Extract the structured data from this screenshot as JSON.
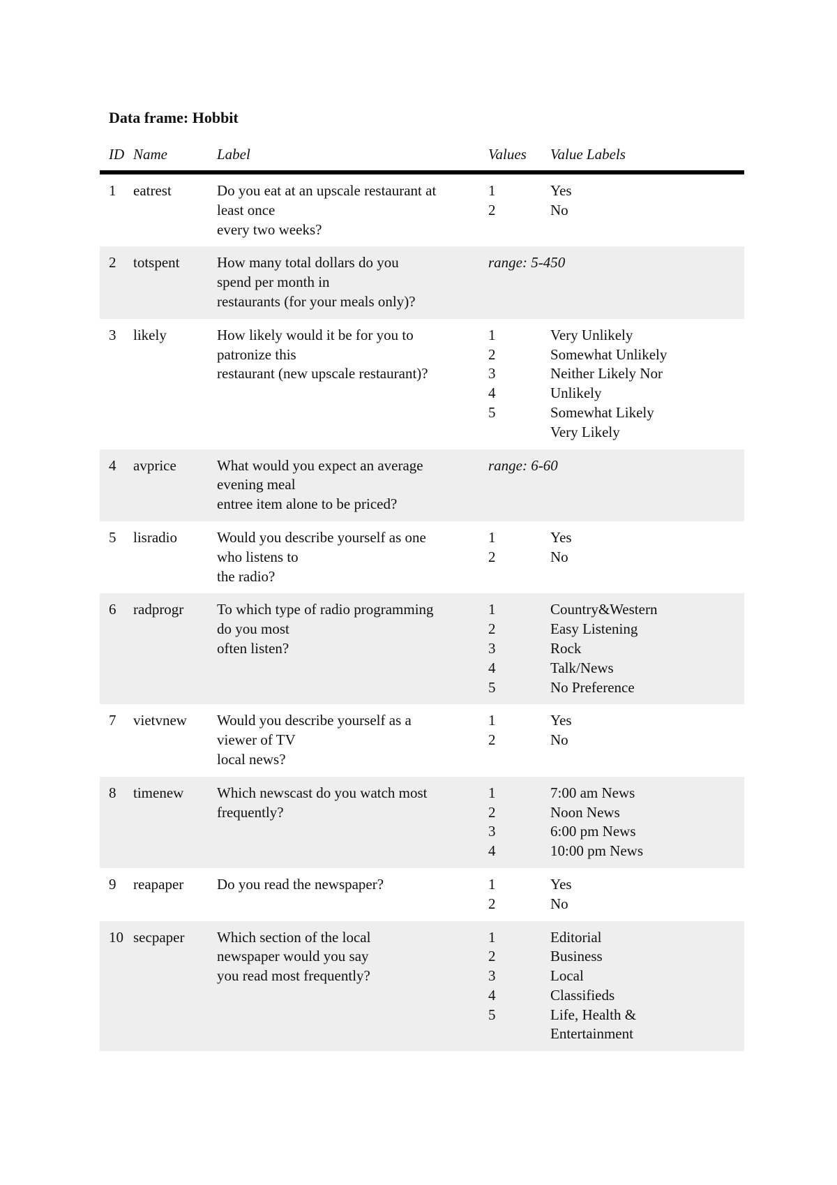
{
  "title": "Data frame: Hobbit",
  "columns": {
    "id": "ID",
    "name": "Name",
    "label": "Label",
    "values": "Values",
    "value_labels": "Value Labels"
  },
  "rows": [
    {
      "id": "1",
      "name": "eatrest",
      "label": [
        "Do you eat at an upscale restaurant at",
        "least once",
        "every two weeks?"
      ],
      "range": null,
      "values": [
        "1",
        "2"
      ],
      "value_labels": [
        "Yes",
        "No"
      ],
      "shaded": false
    },
    {
      "id": "2",
      "name": "totspent",
      "label": [
        "How many total dollars do you",
        "spend per month in",
        "restaurants (for your meals only)?"
      ],
      "range": "range: 5-450",
      "values": [],
      "value_labels": [],
      "shaded": true
    },
    {
      "id": "3",
      "name": "likely",
      "label": [
        "How likely would it be for you to",
        "patronize this",
        "restaurant (new upscale restaurant)?"
      ],
      "range": null,
      "values": [
        "1",
        "2",
        "3",
        "4",
        "5"
      ],
      "value_labels": [
        "Very Unlikely",
        "Somewhat Unlikely",
        "Neither Likely Nor",
        "Unlikely",
        "Somewhat Likely",
        "Very Likely"
      ],
      "shaded": false
    },
    {
      "id": "4",
      "name": "avprice",
      "label": [
        "What would you expect an average",
        "evening meal",
        "entree item alone to be priced?"
      ],
      "range": "range: 6-60",
      "values": [],
      "value_labels": [],
      "shaded": true
    },
    {
      "id": "5",
      "name": "lisradio",
      "label": [
        "Would you describe yourself as one",
        "who listens to",
        "the radio?"
      ],
      "range": null,
      "values": [
        "1",
        "2"
      ],
      "value_labels": [
        "Yes",
        "No"
      ],
      "shaded": false
    },
    {
      "id": "6",
      "name": "radprogr",
      "label": [
        "To which type of radio programming",
        "do you most",
        "often listen?"
      ],
      "range": null,
      "values": [
        "1",
        "2",
        "3",
        "4",
        "5"
      ],
      "value_labels": [
        "Country&Western",
        "Easy Listening",
        "Rock",
        "Talk/News",
        "No Preference"
      ],
      "shaded": true
    },
    {
      "id": "7",
      "name": "vietvnew",
      "label": [
        "Would you describe yourself as a",
        "viewer of TV",
        "local news?"
      ],
      "range": null,
      "values": [
        "1",
        "2"
      ],
      "value_labels": [
        "Yes",
        "No"
      ],
      "shaded": false
    },
    {
      "id": "8",
      "name": "timenew",
      "label": [
        "Which newscast do you watch most",
        "frequently?"
      ],
      "range": null,
      "values": [
        "1",
        "2",
        "3",
        "4"
      ],
      "value_labels": [
        "7:00 am News",
        "Noon News",
        "6:00 pm News",
        "10:00 pm News"
      ],
      "shaded": true
    },
    {
      "id": "9",
      "name": "reapaper",
      "label": [
        "Do you read the newspaper?"
      ],
      "range": null,
      "values": [
        "1",
        "2"
      ],
      "value_labels": [
        "Yes",
        "No"
      ],
      "shaded": false
    },
    {
      "id": "10",
      "name": "secpaper",
      "label": [
        "Which section of the local",
        "newspaper would you say",
        "you read most frequently?"
      ],
      "range": null,
      "values": [
        "1",
        "2",
        "3",
        "4",
        "5"
      ],
      "value_labels": [
        "Editorial",
        "Business",
        "Local",
        "Classifieds",
        "Life, Health &",
        "Entertainment"
      ],
      "shaded": true
    }
  ]
}
